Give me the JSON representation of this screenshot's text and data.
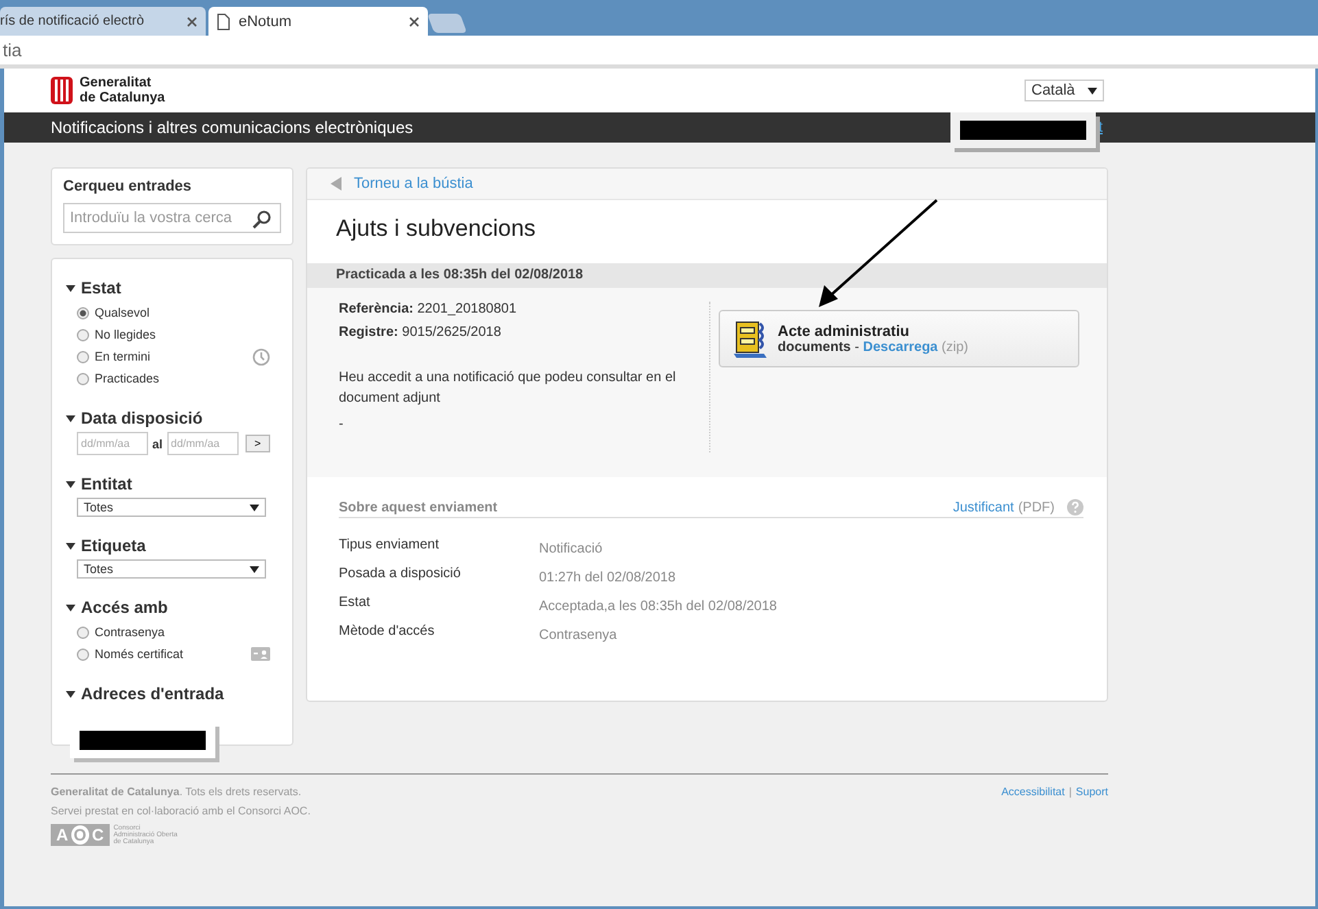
{
  "browser": {
    "tabs": [
      {
        "title": "rís de notificació electrò",
        "selected": false
      },
      {
        "title": "eNotum",
        "selected": true
      }
    ],
    "address": "tia"
  },
  "header": {
    "logo_lines": [
      "Generalitat",
      "de Catalunya"
    ],
    "language": "Català",
    "banner_title": "Notificacions i altres comunicacions electròniques",
    "banner_link": "t"
  },
  "sidebar": {
    "search": {
      "title": "Cerqueu entrades",
      "placeholder": "Introduïu la vostra cerca"
    },
    "filters": [
      {
        "kind": "radio",
        "title": "Estat",
        "options": [
          {
            "label": "Qualsevol",
            "selected": true
          },
          {
            "label": "No llegides",
            "selected": false
          },
          {
            "label": "En termini",
            "selected": false
          },
          {
            "label": "Practicades",
            "selected": false
          }
        ]
      },
      {
        "kind": "date",
        "title": "Data disposició",
        "from_placeholder": "dd/mm/aa",
        "separator": "al",
        "to_placeholder": "dd/mm/aa",
        "button": ">"
      },
      {
        "kind": "select",
        "title": "Entitat",
        "value": "Totes"
      },
      {
        "kind": "select",
        "title": "Etiqueta",
        "value": "Totes"
      },
      {
        "kind": "radio",
        "title": "Accés amb",
        "options": [
          {
            "label": "Contrasenya",
            "selected": false
          },
          {
            "label": "Només certificat",
            "selected": false
          }
        ]
      },
      {
        "kind": "redacted",
        "title": "Adreces d'entrada"
      }
    ]
  },
  "main": {
    "back_link": "Torneu a la bústia",
    "title": "Ajuts i subvencions",
    "status": "Practicada a les 08:35h del 02/08/2018",
    "details": [
      {
        "label": "Referència:",
        "value": "2201_20180801"
      },
      {
        "label": "Registre:",
        "value": "9015/2625/2018"
      }
    ],
    "message": "Heu accedit a una notificació que podeu consultar en el document adjunt",
    "dash": "-",
    "attachment": {
      "title": "Acte administratiu",
      "type": "documents",
      "separator": "-",
      "link": "Descarrega",
      "format": "(zip)"
    },
    "about": {
      "title": "Sobre aquest enviament",
      "link": "Justificant",
      "link_suffix": "(PDF)",
      "rows": [
        {
          "label": "Tipus enviament",
          "value": "Notificació"
        },
        {
          "label": "Posada a disposició",
          "value": "01:27h del 02/08/2018"
        },
        {
          "label": "Estat",
          "value": "Acceptada,a les 08:35h del 02/08/2018"
        },
        {
          "label": "Mètode d'accés",
          "value": "Contrasenya"
        }
      ]
    }
  },
  "footer": {
    "rights": "**Generalitat de Catalunya**. Tots els drets reservats.",
    "service": "Servei prestat en col·laboració amb el Consorci AOC.",
    "links": [
      "Accessibilitat",
      "Suport"
    ],
    "link_separator": "|",
    "logo": {
      "letters": [
        "A",
        "O",
        "C"
      ],
      "caption": [
        "Consorci",
        "Administració Oberta",
        "de Catalunya"
      ]
    }
  }
}
